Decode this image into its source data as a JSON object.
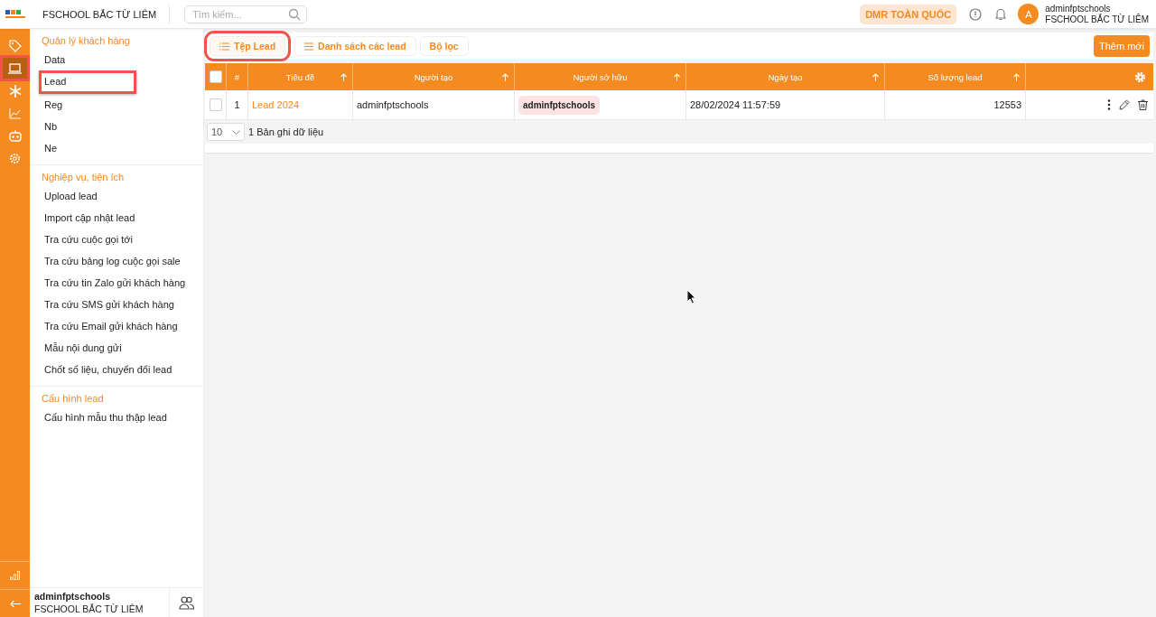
{
  "header": {
    "org": "FSCHOOL BẮC TỪ LIÊM",
    "search": {
      "placeholder": "Tìm kiếm..."
    },
    "scope": "DMR TOÀN QUỐC",
    "avatar": "A",
    "user": "adminfptschools",
    "user_org": "FSCHOOL BẮC TỪ LIÊM"
  },
  "rail": [
    {
      "kind": "tag",
      "selected": false,
      "highlighted": false
    },
    {
      "kind": "laptop",
      "selected": true,
      "highlighted": true
    },
    {
      "kind": "asterisk",
      "selected": false,
      "highlighted": false
    },
    {
      "kind": "chart",
      "selected": false,
      "highlighted": false
    },
    {
      "kind": "robot",
      "selected": false,
      "highlighted": false
    },
    {
      "kind": "gear",
      "selected": false,
      "highlighted": false
    }
  ],
  "rail_bottom": [
    {
      "kind": "bars"
    },
    {
      "kind": "back"
    }
  ],
  "sidebar": {
    "groups": [
      {
        "title": "Quản lý khách hàng",
        "items": [
          {
            "label": "Data",
            "highlighted": false
          },
          {
            "label": "Lead",
            "highlighted": true
          },
          {
            "label": "Reg",
            "highlighted": false
          },
          {
            "label": "Nb",
            "highlighted": false
          },
          {
            "label": "Ne",
            "highlighted": false
          }
        ]
      },
      {
        "title": "Nghiệp vụ, tiện ích",
        "items": [
          {
            "label": "Upload lead",
            "highlighted": false
          },
          {
            "label": "Import cập nhật lead",
            "highlighted": false
          },
          {
            "label": "Tra cứu cuộc gọi tới",
            "highlighted": false
          },
          {
            "label": "Tra cứu bảng log cuộc gọi sale",
            "highlighted": false
          },
          {
            "label": "Tra cứu tin Zalo gửi khách hàng",
            "highlighted": false
          },
          {
            "label": "Tra cứu SMS gửi khách hàng",
            "highlighted": false
          },
          {
            "label": "Tra cứu Email gửi khách hàng",
            "highlighted": false
          },
          {
            "label": "Mẫu nội dung gửi",
            "highlighted": false
          },
          {
            "label": "Chốt số liệu, chuyển đổi lead",
            "highlighted": false
          }
        ]
      },
      {
        "title": "Cấu hình lead",
        "items": [
          {
            "label": "Cấu hình mẫu thu thập lead",
            "highlighted": false
          }
        ]
      }
    ],
    "footer": {
      "user": "adminfptschools",
      "org": "FSCHOOL BẮC TỪ LIÊM"
    }
  },
  "tabs": [
    {
      "label": "Tệp Lead",
      "kind": "list",
      "selected": true,
      "highlighted": true
    },
    {
      "label": "Danh sách các lead",
      "kind": "lines",
      "selected": false,
      "highlighted": false
    },
    {
      "label": "Bộ lọc",
      "kind": "plain",
      "selected": false,
      "highlighted": false
    }
  ],
  "add_button": "Thêm mới",
  "table": {
    "all_checked": false,
    "columns": [
      "#",
      "Tiêu đề",
      "Người tạo",
      "Người sở hữu",
      "Ngày tạo",
      "Số lượng lead"
    ],
    "rows": [
      {
        "checked": false,
        "index": "1",
        "title": "Lead 2024",
        "creator": "adminfptschools",
        "owner": "adminfptschools",
        "created": "28/02/2024 11:57:59",
        "count": "12553"
      }
    ],
    "page_size": "10",
    "summary": "1 Bản ghi dữ liệu"
  }
}
